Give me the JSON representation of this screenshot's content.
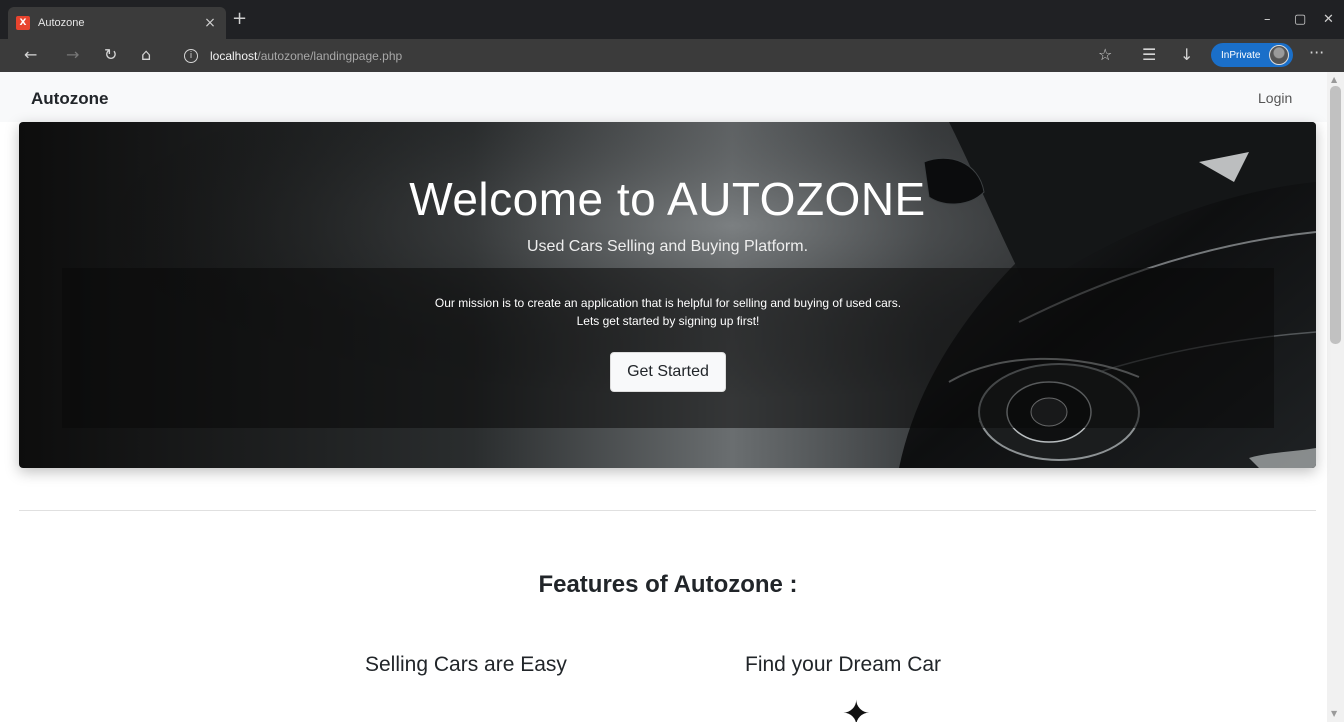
{
  "browser": {
    "tab_title": "Autozone",
    "tab_favicon_glyph": "X",
    "tab_close": "×",
    "new_tab": "+",
    "window_controls": {
      "minimize": "–",
      "restore": "▢",
      "close": "✕"
    },
    "nav": {
      "back": "←",
      "forward": "→",
      "refresh": "↻",
      "home": "⌂"
    },
    "url": {
      "host": "localhost",
      "path": "/autozone/landingpage.php",
      "info_icon": "i"
    },
    "toolbar_icons": {
      "favorite_add": "☆",
      "favorites": "☰",
      "downloads": "↓",
      "more": "···"
    },
    "inprivate_label": "InPrivate"
  },
  "navbar": {
    "brand": "Autozone",
    "login": "Login"
  },
  "hero": {
    "title": "Welcome to AUTOZONE",
    "subtitle": "Used Cars Selling and Buying Platform.",
    "mission_line_1": "Our mission is to create an application that is helpful for selling and buying of used cars.",
    "mission_line_2": "Lets get started by signing up first!",
    "cta_label": "Get Started"
  },
  "features": {
    "title": "Features of Autozone :",
    "items": [
      {
        "label": "Selling Cars are Easy"
      },
      {
        "label": "Find your Dream Car",
        "icon": "star-icon",
        "icon_glyph": "✦"
      }
    ]
  },
  "colors": {
    "tabbar_bg": "#202124",
    "toolbar_bg": "#3b3b3b",
    "inprivate_blue": "#1a6fc9",
    "navbar_bg": "#f8f9fa",
    "text_dark": "#212529"
  }
}
